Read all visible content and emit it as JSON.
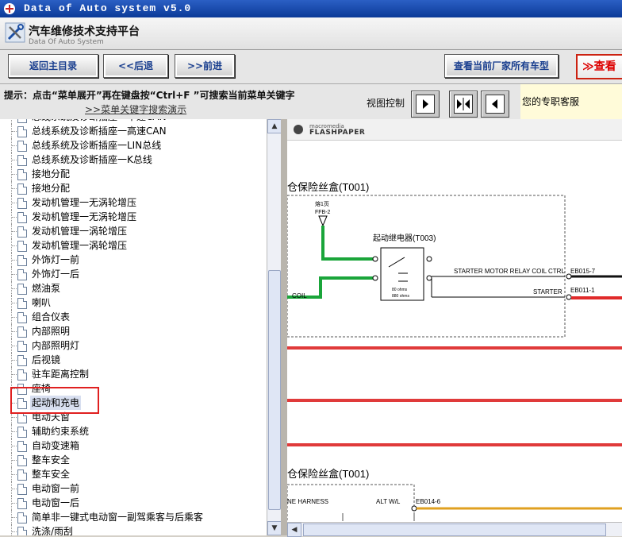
{
  "window": {
    "title": "Data of Auto system v5.0"
  },
  "app": {
    "title": "汽车维修技术支持平台",
    "subtitle": "Data Of Auto System"
  },
  "toolbar": {
    "home": "返回主目录",
    "back": "<<后退",
    "forward": ">>前进",
    "view_all": "查看当前厂家所有车型",
    "view_more": "≫查看"
  },
  "tip": {
    "text": "提示：点击“菜单展开”再在键盘按“Ctrl+F ”可搜索当前菜单关键字",
    "demo_link": ">>菜单关键字搜索演示"
  },
  "view_control": {
    "label": "视图控制"
  },
  "service": {
    "label": "您的专职客服"
  },
  "tree": {
    "items": [
      "总线系统及诊断插座一中速CAN",
      "总线系统及诊断插座一高速CAN",
      "总线系统及诊断插座一LIN总线",
      "总线系统及诊断插座一K总线",
      "接地分配",
      "接地分配",
      "发动机管理一无涡轮增压",
      "发动机管理一无涡轮增压",
      "发动机管理一涡轮增压",
      "发动机管理一涡轮增压",
      "外饰灯一前",
      "外饰灯一后",
      "燃油泵",
      "喇叭",
      "组合仪表",
      "内部照明",
      "内部照明灯",
      "后视镜",
      "驻车距离控制",
      "座椅",
      "起动和充电",
      "电动天窗",
      "辅助约束系统",
      "自动变速箱",
      "整车安全",
      "整车安全",
      "电动窗一前",
      "电动窗一后",
      "简单非一键式电动窗一副驾乘客与后乘客",
      "洗涤/雨刮"
    ],
    "selected_index": 20
  },
  "viewer": {
    "brand_top": "macromedia",
    "brand": "FLASHPAPER",
    "diagram": {
      "box1_title": "仓保险丝盒(T001)",
      "fuse_label": "熔1页",
      "fuse_sub": "FFB-2",
      "relay_title": "起动继电器(T003)",
      "relay_text1": "80 ohms",
      "relay_text2": "880 ohms",
      "coil": "COIL",
      "wire1": "STARTER MOTOR RELAY COIL CTRL",
      "wire2": "STARTER",
      "term1": "EB015-7",
      "term2": "EB011-1",
      "box2_title": "仓保险丝盒(T001)",
      "harness": "NE HARNESS",
      "alt": "ALT W/L",
      "term3": "EB014-6"
    }
  }
}
